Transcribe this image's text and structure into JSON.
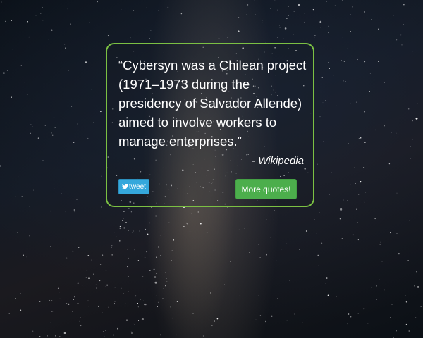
{
  "background": {
    "description_icon": "starry-night-milky-way"
  },
  "quote": {
    "text": "“Cybersyn was a Chilean project (1971–1973 during the presidency of Salvador Allende) aimed to involve workers to manage enterprises.”",
    "author": "- Wikipedia"
  },
  "buttons": {
    "tweet_label": "tweet",
    "tweet_icon": "twitter-bird-icon",
    "more_label": "More quotes!"
  },
  "colors": {
    "border_accent": "#7bc043",
    "tweet_button": "#35a8dc",
    "more_button": "#4cae4c"
  }
}
